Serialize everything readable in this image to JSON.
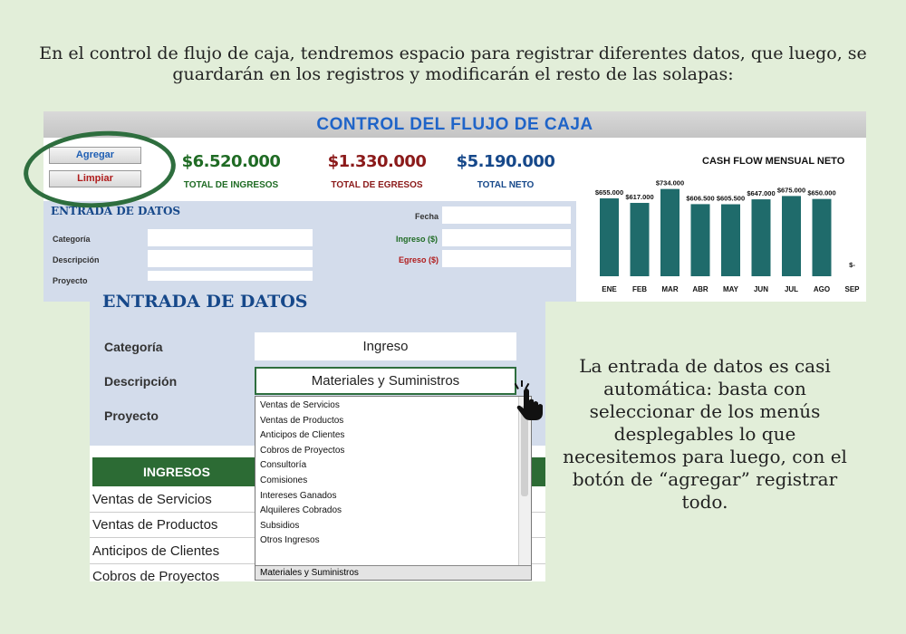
{
  "caption_top": "En el control de flujo de caja, tendremos espacio para registrar diferentes datos, que luego, se guardarán en los registros y modificarán el resto de las solapas:",
  "caption_right": "La entrada de datos es casi automática: basta con seleccionar de los menús desplegables lo que necesitemos para luego, con el botón de “agregar” registrar todo.",
  "sheet": {
    "title": "CONTROL DEL FLUJO DE CAJA",
    "buttons": {
      "agregar": "Agregar",
      "limpiar": "Limpiar"
    },
    "totals": [
      {
        "amount": "$6.520.000",
        "label": "TOTAL DE INGRESOS"
      },
      {
        "amount": "$1.330.000",
        "label": "TOTAL DE EGRESOS"
      },
      {
        "amount": "$5.190.000",
        "label": "TOTAL NETO"
      }
    ],
    "entry": {
      "title": "ENTRADA DE DATOS",
      "fields": {
        "fecha": "Fecha",
        "categoria": "Categoría",
        "ingreso": "Ingreso ($)",
        "descripcion": "Descripción",
        "egreso": "Egreso ($)",
        "proyecto": "Proyecto"
      }
    }
  },
  "chart_data": {
    "type": "bar",
    "title": "CASH FLOW MENSUAL NETO",
    "categories": [
      "ENE",
      "FEB",
      "MAR",
      "ABR",
      "MAY",
      "JUN",
      "JUL",
      "AGO",
      "SEP"
    ],
    "values": [
      655000,
      617000,
      734000,
      606500,
      605500,
      647000,
      675000,
      650000,
      0
    ],
    "labels": [
      "$655.000",
      "$617.000",
      "$734.000",
      "$606.500",
      "$605.500",
      "$647.000",
      "$675.000",
      "$650.000",
      "$-"
    ],
    "color": "#1f6b6b",
    "ylim": [
      0,
      800000
    ],
    "grid": false
  },
  "front": {
    "title": "ENTRADA DE DATOS",
    "categoria_label": "Categoría",
    "categoria_value": "Ingreso",
    "descripcion_label": "Descripción",
    "descripcion_value": "Materiales y Suministros",
    "proyecto_label": "Proyecto",
    "ingresos_header": "INGRESOS",
    "rows": [
      "Ventas de Servicios",
      "Ventas de Productos",
      "Anticipos de Clientes",
      "Cobros de Proyectos"
    ]
  },
  "dropdown": {
    "options": [
      "Ventas de Servicios",
      "Ventas de Productos",
      "Anticipos de Clientes",
      "Cobros de Proyectos",
      "Consultoría",
      "Comisiones",
      "Intereses Ganados",
      "Alquileres Cobrados",
      "Subsidios",
      "Otros Ingresos"
    ],
    "selected": "Materiales y Suministros"
  }
}
